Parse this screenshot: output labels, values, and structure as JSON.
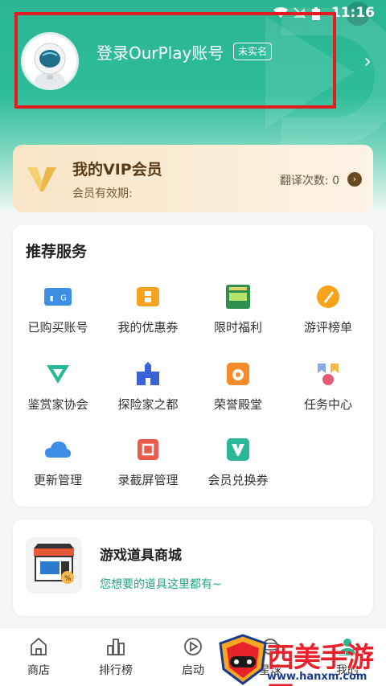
{
  "status": {
    "time": "11:16"
  },
  "profile": {
    "login_title": "登录OurPlay账号",
    "badge": "未实名"
  },
  "vip": {
    "title": "我的VIP会员",
    "subtitle": "会员有效期:",
    "translate_label": "翻译次数: 0"
  },
  "services": {
    "title": "推荐服务",
    "items": [
      {
        "label": "已购买账号",
        "icon": "purchased-account-icon"
      },
      {
        "label": "我的优惠券",
        "icon": "coupon-icon"
      },
      {
        "label": "限时福利",
        "icon": "limited-welfare-icon"
      },
      {
        "label": "游评榜单",
        "icon": "game-review-list-icon"
      },
      {
        "label": "鉴赏家协会",
        "icon": "connoisseur-icon"
      },
      {
        "label": "探险家之都",
        "icon": "explorer-castle-icon"
      },
      {
        "label": "荣誉殿堂",
        "icon": "honor-hall-icon"
      },
      {
        "label": "任务中心",
        "icon": "task-center-icon"
      },
      {
        "label": "更新管理",
        "icon": "cloud-update-icon"
      },
      {
        "label": "录截屏管理",
        "icon": "screen-record-icon"
      },
      {
        "label": "会员兑换券",
        "icon": "vip-voucher-icon"
      }
    ]
  },
  "shop": {
    "title": "游戏道具商城",
    "subtitle": "您想要的道具这里都有~"
  },
  "nav": {
    "items": [
      {
        "label": "商店",
        "icon": "store-icon"
      },
      {
        "label": "排行榜",
        "icon": "ranking-icon"
      },
      {
        "label": "启动",
        "icon": "launch-icon"
      },
      {
        "label": "星球",
        "icon": "planet-icon"
      },
      {
        "label": "我的",
        "icon": "profile-icon"
      }
    ]
  },
  "watermark": {
    "text": "西美手游网",
    "url": "www.hanxm.com"
  },
  "colors": {
    "brand_green": "#2cb593",
    "highlight_red": "#e31c23",
    "vip_brown": "#5a3b17"
  }
}
